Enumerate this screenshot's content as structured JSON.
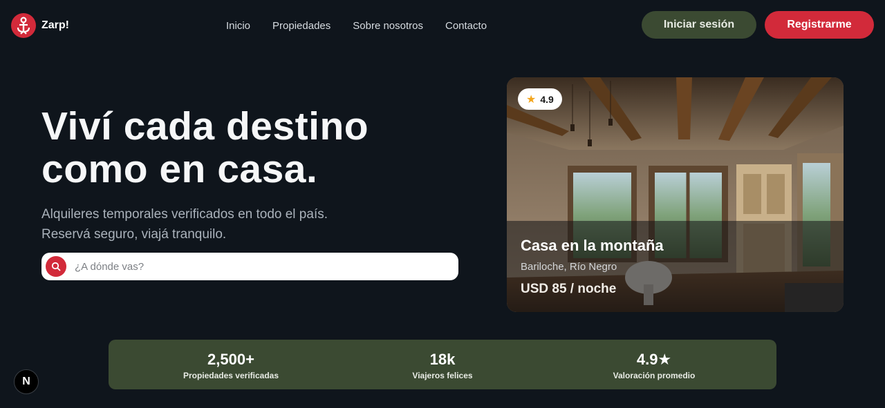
{
  "brand": {
    "name": "Zarp!",
    "icon": "anchor-person-icon",
    "accent": "#d22a3a"
  },
  "nav": {
    "items": [
      {
        "label": "Inicio"
      },
      {
        "label": "Propiedades"
      },
      {
        "label": "Sobre nosotros"
      },
      {
        "label": "Contacto"
      }
    ]
  },
  "auth": {
    "login_label": "Iniciar sesión",
    "register_label": "Registrarme"
  },
  "hero": {
    "title_line1": "Viví cada destino",
    "title_line2": "como en casa.",
    "subtitle_line1": "Alquileres temporales verificados en todo el país.",
    "subtitle_line2": "Reservá seguro, viajá tranquilo.",
    "search_placeholder": "¿A dónde vas?",
    "search_value": ""
  },
  "featured": {
    "rating": "4.9",
    "title": "Casa en la montaña",
    "location": "Bariloche, Río Negro",
    "price": "USD 85 / noche"
  },
  "stats": [
    {
      "value": "2,500+",
      "label": "Propiedades verificadas"
    },
    {
      "value": "18k",
      "label": "Viajeros felices"
    },
    {
      "value": "4.9★",
      "label": "Valoración promedio"
    }
  ],
  "dev_badge": {
    "label": "N"
  },
  "colors": {
    "background": "#0f151c",
    "olive": "#3b4a32",
    "red": "#d22a3a"
  }
}
